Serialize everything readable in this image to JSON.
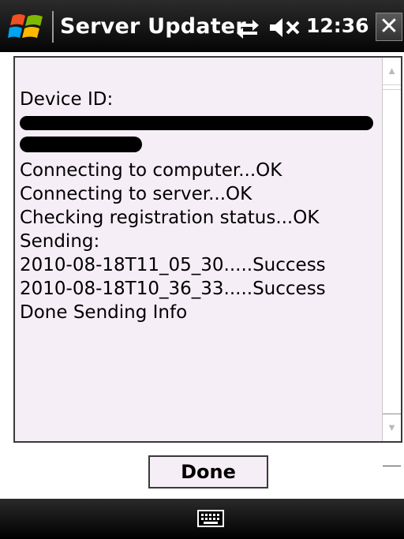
{
  "window": {
    "title": "Server Updater",
    "clock": "12:36",
    "close_label": "✕"
  },
  "status_icons": [
    "windows-logo",
    "connectivity-arrows-icon",
    "speaker-muted-icon"
  ],
  "log": {
    "lines": [
      "Device ID:",
      "Connecting to computer...OK",
      "Connecting to server...OK",
      "Checking registration status...OK",
      "Sending:",
      "2010-08-18T11_05_30.....Success",
      "2010-08-18T10_36_33.....Success",
      "Done Sending Info"
    ]
  },
  "buttons": {
    "done_label": "Done"
  },
  "colors": {
    "titlebar": "#1a1a1a",
    "textbox_bg": "#f6eef6",
    "border": "#3a3a3a"
  },
  "bottom_bar": {
    "icon": "keyboard-icon"
  }
}
